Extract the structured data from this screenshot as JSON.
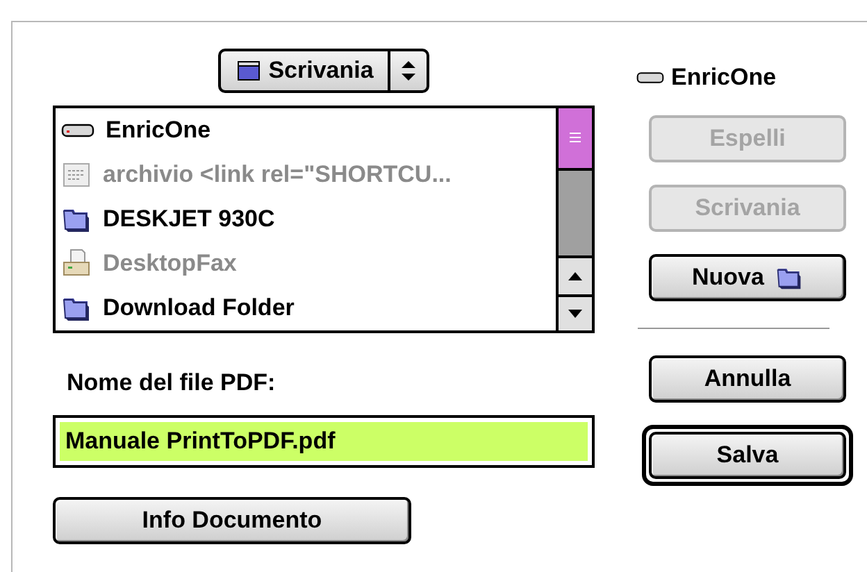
{
  "location_popup": {
    "label": "Scrivania"
  },
  "file_list": {
    "items": [
      {
        "name": "EnricOne",
        "kind": "disk",
        "disabled": false
      },
      {
        "name": "archivio <link rel=\"SHORTCU...",
        "kind": "document",
        "disabled": true
      },
      {
        "name": "DESKJET 930C",
        "kind": "folder",
        "disabled": false
      },
      {
        "name": "DesktopFax",
        "kind": "printer",
        "disabled": true
      },
      {
        "name": "Download Folder",
        "kind": "folder",
        "disabled": false
      }
    ]
  },
  "filename_label": "Nome del file PDF:",
  "filename_field": {
    "value": "Manuale PrintToPDF.pdf",
    "text_selected": true
  },
  "info_button": {
    "label": "Info Documento"
  },
  "volume": {
    "name": "EnricOne"
  },
  "side_buttons": [
    {
      "label": "Espelli",
      "disabled": true,
      "default": false,
      "kind": "plain"
    },
    {
      "label": "Scrivania",
      "disabled": true,
      "default": false,
      "kind": "plain"
    },
    {
      "label": "Nuova",
      "disabled": false,
      "default": false,
      "kind": "new-folder"
    },
    {
      "label": "Annulla",
      "disabled": false,
      "default": false,
      "kind": "plain"
    },
    {
      "label": "Salva",
      "disabled": false,
      "default": true,
      "kind": "plain"
    }
  ]
}
